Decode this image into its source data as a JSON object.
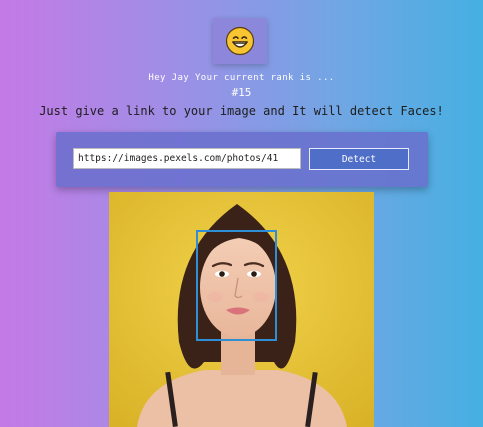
{
  "header": {
    "logo_emoji": "grinning-face-with-smiling-eyes",
    "greeting": "Hey Jay Your current rank is ...",
    "rank": "#15",
    "tagline": "Just give a link to your image and It will detect Faces!"
  },
  "form": {
    "url_value": "https://images.pexels.com/photos/41",
    "detect_label": "Detect"
  },
  "result": {
    "image_description": "portrait photo of a woman on a yellow background",
    "detected_faces": 1,
    "box_color": "#2f8fd6"
  },
  "colors": {
    "gradient_start": "#c47ae6",
    "gradient_end": "#45b0e2",
    "button": "#4f6ec8",
    "card": "#686ecd"
  }
}
